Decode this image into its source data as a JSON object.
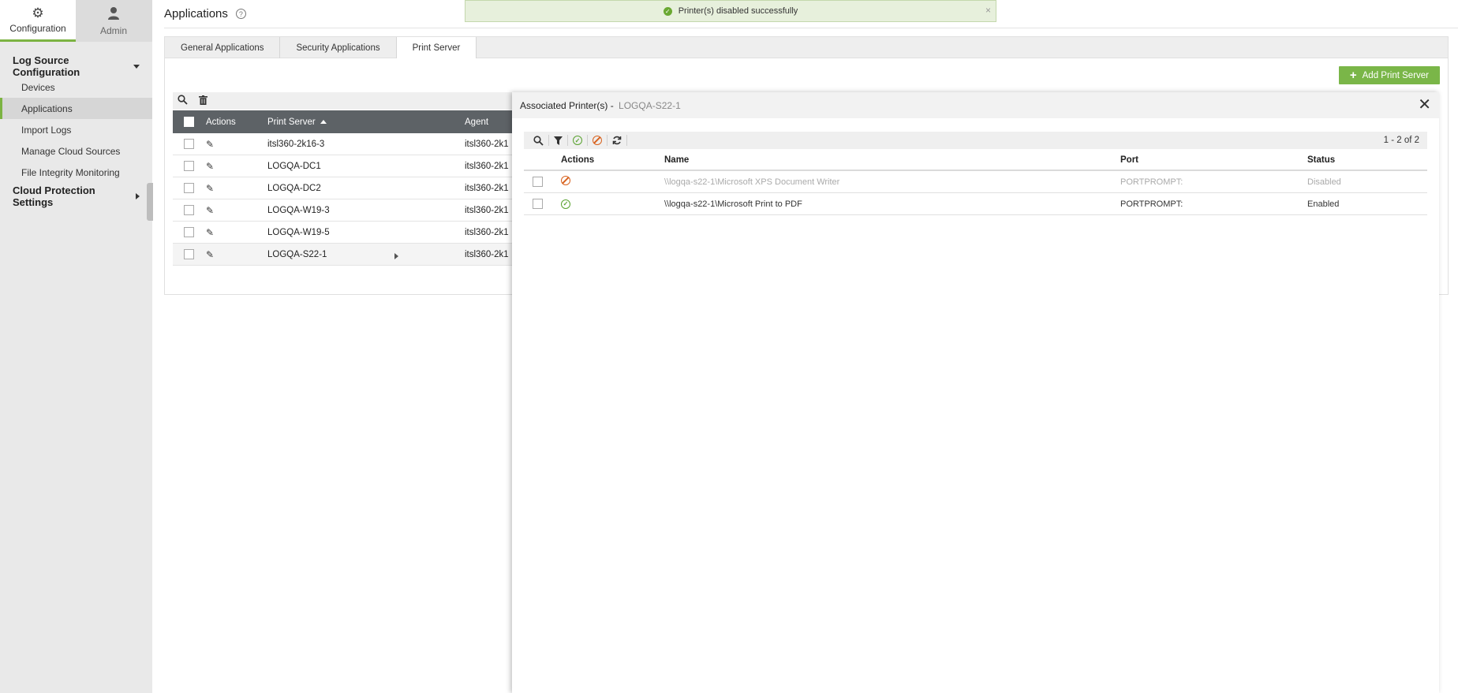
{
  "topnav": {
    "configuration": "Configuration",
    "admin": "Admin"
  },
  "sidebar": {
    "section1": "Log Source Configuration",
    "items": [
      "Devices",
      "Applications",
      "Import Logs",
      "Manage Cloud Sources",
      "File Integrity Monitoring"
    ],
    "active_item": "Applications",
    "section2": "Cloud Protection Settings"
  },
  "page": {
    "title": "Applications",
    "help": "?"
  },
  "toast": {
    "message": "Printer(s) disabled successfully",
    "close": "×"
  },
  "tabs": [
    "General Applications",
    "Security Applications",
    "Print Server"
  ],
  "active_tab": "Print Server",
  "add_button": "Add Print Server",
  "server_grid": {
    "columns": [
      "Actions",
      "Print Server",
      "Agent"
    ],
    "rows": [
      {
        "server": "itsl360-2k16-3",
        "agent": "itsl360-2k1"
      },
      {
        "server": "LOGQA-DC1",
        "agent": "itsl360-2k1"
      },
      {
        "server": "LOGQA-DC2",
        "agent": "itsl360-2k1"
      },
      {
        "server": "LOGQA-W19-3",
        "agent": "itsl360-2k1"
      },
      {
        "server": "LOGQA-W19-5",
        "agent": "itsl360-2k1"
      },
      {
        "server": "LOGQA-S22-1",
        "agent": "itsl360-2k1"
      }
    ]
  },
  "slide": {
    "title": "Associated Printer(s) - ",
    "subtitle": "LOGQA-S22-1",
    "count": "1 - 2 of 2",
    "columns": [
      "Actions",
      "Name",
      "Port",
      "Status"
    ],
    "rows": [
      {
        "name": "\\\\logqa-s22-1\\Microsoft XPS Document Writer",
        "port": "PORTPROMPT:",
        "status": "Disabled"
      },
      {
        "name": "\\\\logqa-s22-1\\Microsoft Print to PDF",
        "port": "PORTPROMPT:",
        "status": "Enabled"
      }
    ]
  },
  "colors": {
    "accent": "#7cb342",
    "header": "#5d6266",
    "enabled": "#59a22f",
    "disabled": "#d8621e"
  }
}
